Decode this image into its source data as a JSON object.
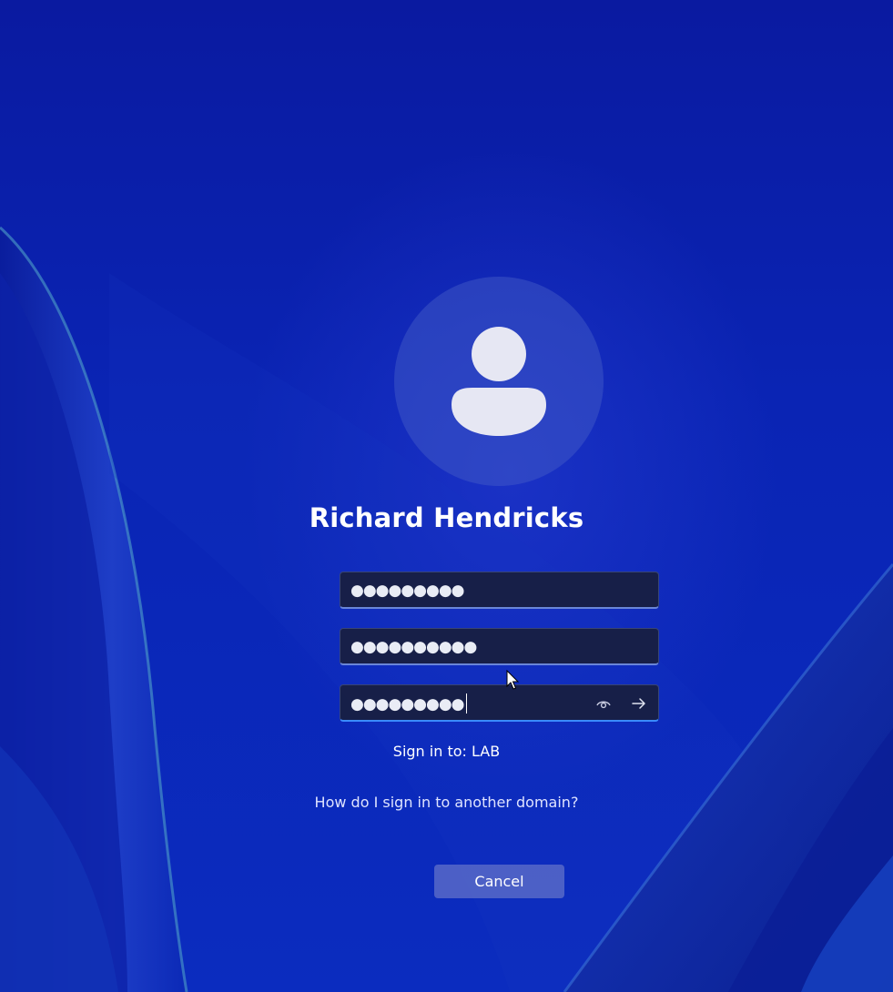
{
  "user": {
    "name": "Richard Hendricks",
    "avatar_icon": "person-icon"
  },
  "fields": [
    {
      "masked_value": "●●●●●●●●●",
      "focused": false
    },
    {
      "masked_value": "●●●●●●●●●●",
      "focused": false
    },
    {
      "masked_value": "●●●●●●●●●",
      "focused": true
    }
  ],
  "icons": {
    "reveal": "eye-icon",
    "submit": "arrow-right-icon"
  },
  "sign_in_to": "Sign in to: LAB",
  "other_domain_link": "How do I sign in to another domain?",
  "cancel_label": "Cancel",
  "colors": {
    "background": "#0a24b4",
    "field_background": "#181e3e",
    "focus_accent": "#3a8bff",
    "cancel_button": "#5f6ec8"
  }
}
